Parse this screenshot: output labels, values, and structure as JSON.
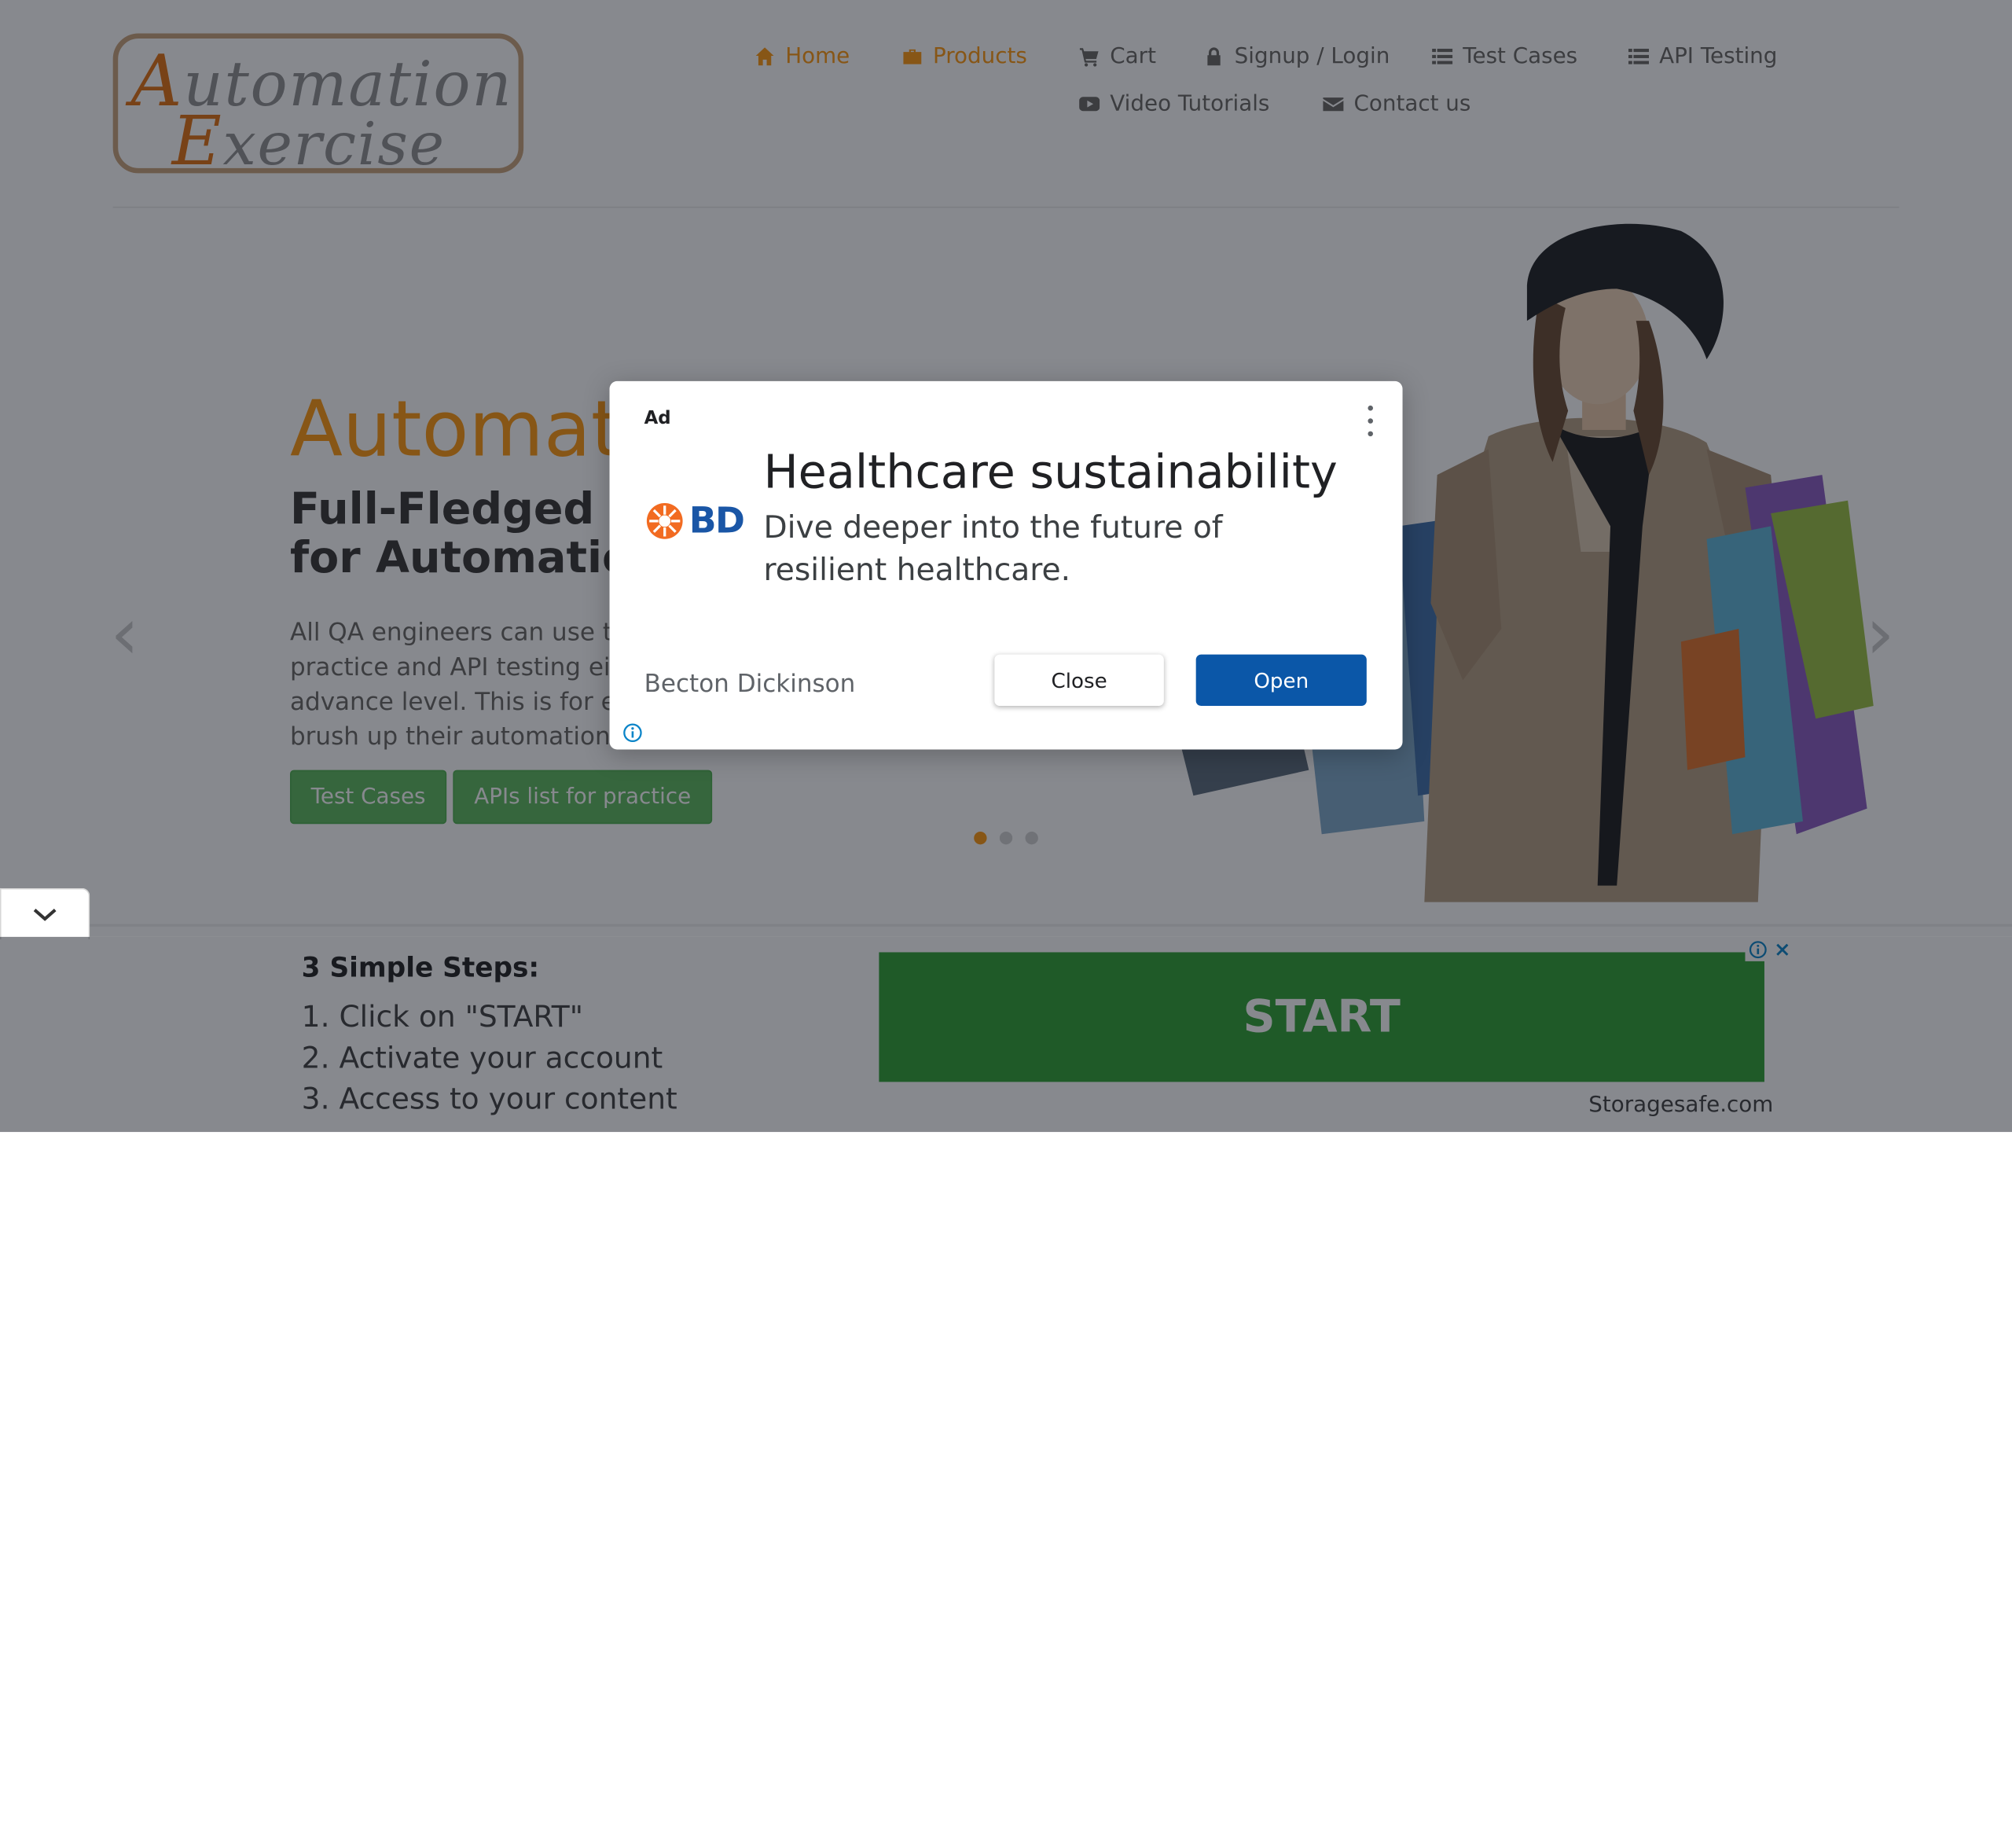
{
  "header": {
    "logo_line1_cap": "A",
    "logo_line1_rest": "utomation",
    "logo_line2_cap": "E",
    "logo_line2_rest": "xercise",
    "nav": [
      {
        "label": "Home",
        "icon": "home-icon"
      },
      {
        "label": "Products",
        "icon": "briefcase-icon"
      },
      {
        "label": "Cart",
        "icon": "cart-icon"
      },
      {
        "label": "Signup / Login",
        "icon": "lock-icon"
      },
      {
        "label": "Test Cases",
        "icon": "list-icon"
      },
      {
        "label": "API Testing",
        "icon": "list-icon"
      },
      {
        "label": "Video Tutorials",
        "icon": "youtube-icon"
      },
      {
        "label": "Contact us",
        "icon": "envelope-icon"
      }
    ]
  },
  "slider": {
    "title": "Automation",
    "subtitle_line1": "Full-Fledged practice website",
    "subtitle_line2": "for Automation Engineers",
    "description": "All QA engineers can use this website for automation practice and API testing either they are at beginner or advance level. This is for everybody to help them brush up their automation skills.",
    "buttons": [
      "Test Cases",
      "APIs list for practice"
    ],
    "prev_arrow": "‹",
    "next_arrow": "›",
    "dots": 3,
    "active_dot": 0
  },
  "modal_ad": {
    "ad_label": "Ad",
    "brand": "BD",
    "headline": "Healthcare sustainability",
    "body": "Dive deeper into the future of resilient healthcare.",
    "advertiser": "Becton Dickinson",
    "close_label": "Close",
    "open_label": "Open"
  },
  "bottom_ad": {
    "title": "3 Simple Steps:",
    "steps": [
      "1. Click on \"START\"",
      "2. Activate your account",
      "3. Access to your content"
    ],
    "cta": "START",
    "link": "Storagesafe.com"
  },
  "colors": {
    "accent": "#fe980f",
    "button_green": "#5cb85c",
    "ad_open_blue": "#0b57a8",
    "start_green": "#2fa033",
    "overlay": "rgba(15,20,30,0.50)"
  }
}
